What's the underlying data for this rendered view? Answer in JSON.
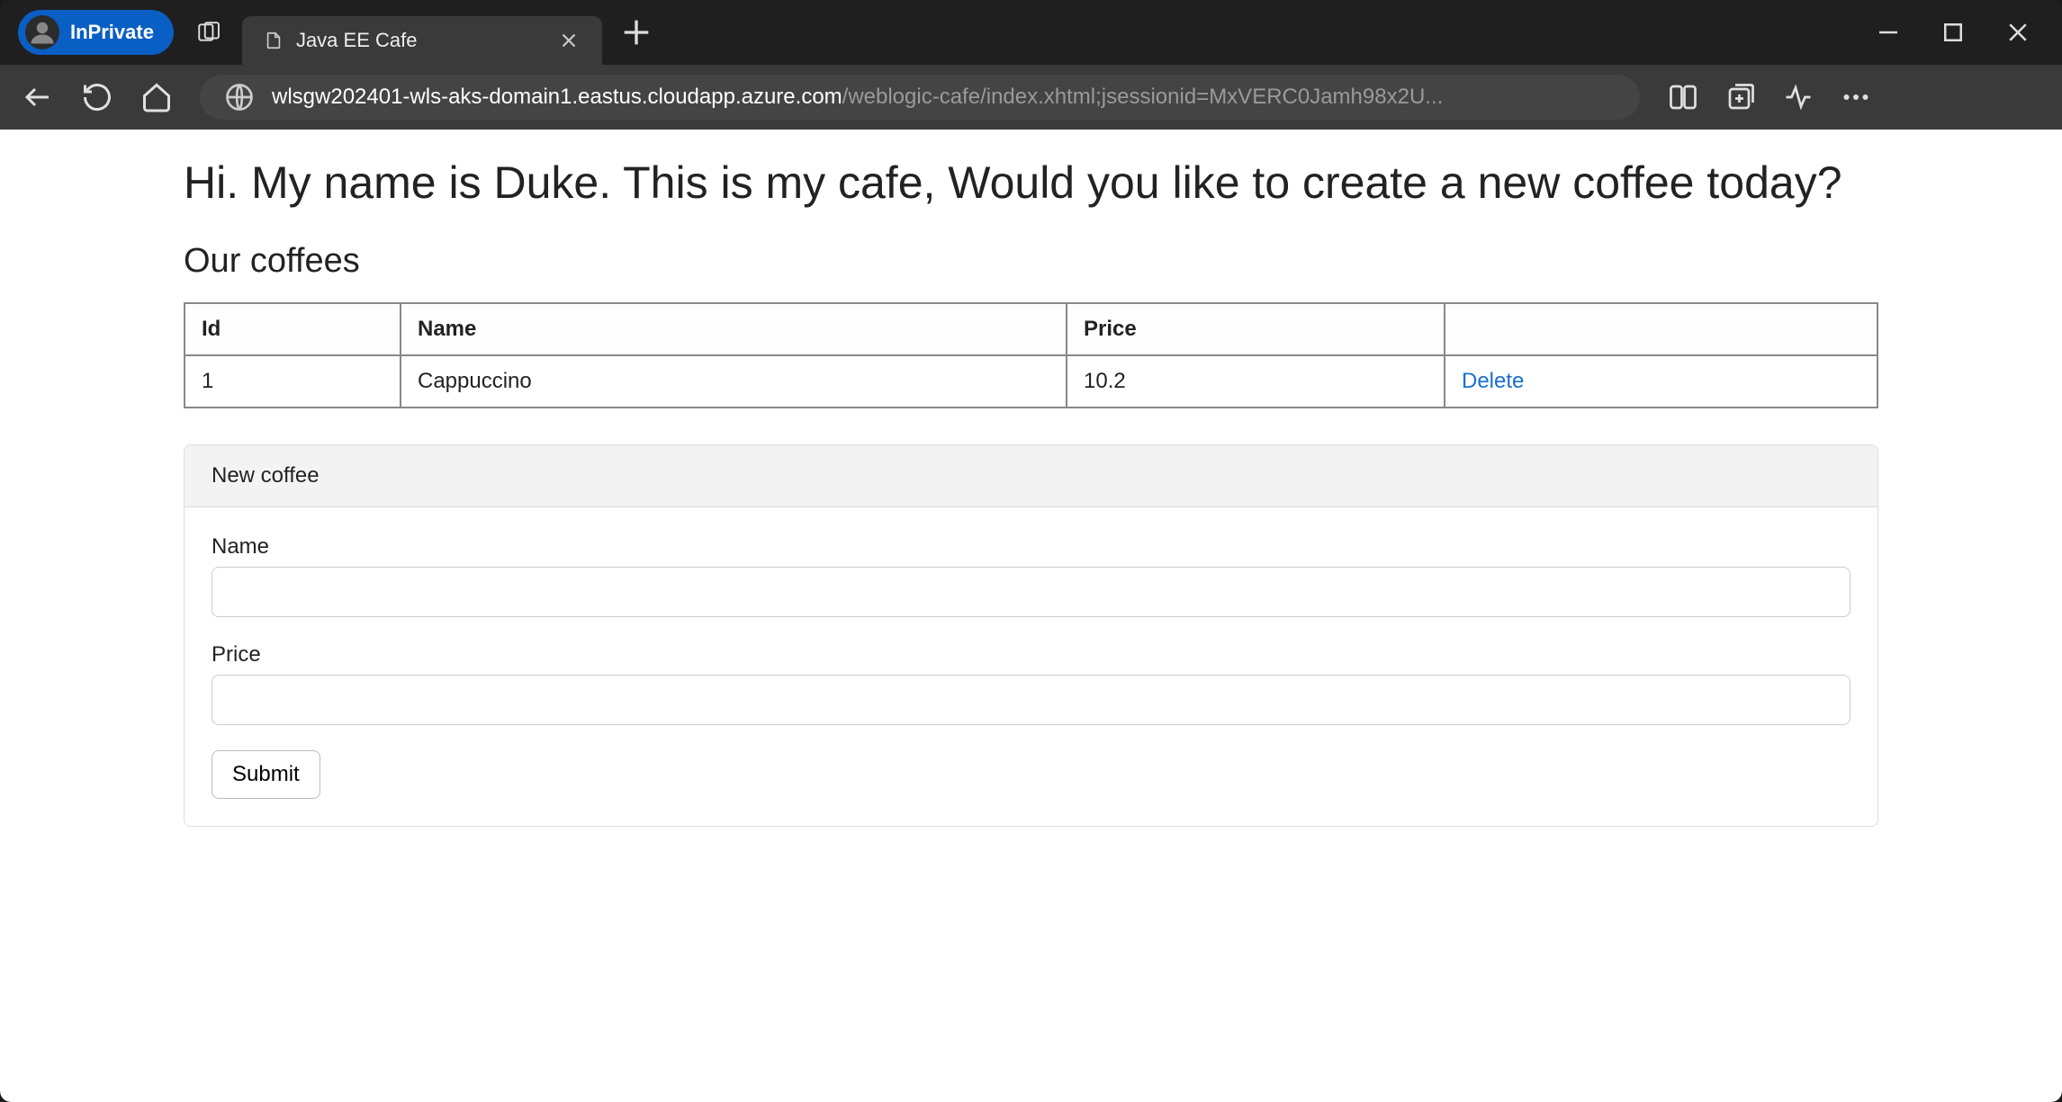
{
  "browser": {
    "inprivate_label": "InPrivate",
    "tab_title": "Java EE Cafe",
    "url_host": "wlsgw202401-wls-aks-domain1.eastus.cloudapp.azure.com",
    "url_path": "/weblogic-cafe/index.xhtml;jsessionid=MxVERC0Jamh98x2U..."
  },
  "page": {
    "heading": "Hi. My name is Duke. This is my cafe, Would you like to create a new coffee today?",
    "subheading": "Our coffees",
    "table": {
      "headers": {
        "id": "Id",
        "name": "Name",
        "price": "Price",
        "actions": ""
      },
      "rows": [
        {
          "id": "1",
          "name": "Cappuccino",
          "price": "10.2",
          "delete_label": "Delete"
        }
      ]
    },
    "form": {
      "panel_title": "New coffee",
      "name_label": "Name",
      "name_value": "",
      "price_label": "Price",
      "price_value": "",
      "submit_label": "Submit"
    }
  }
}
